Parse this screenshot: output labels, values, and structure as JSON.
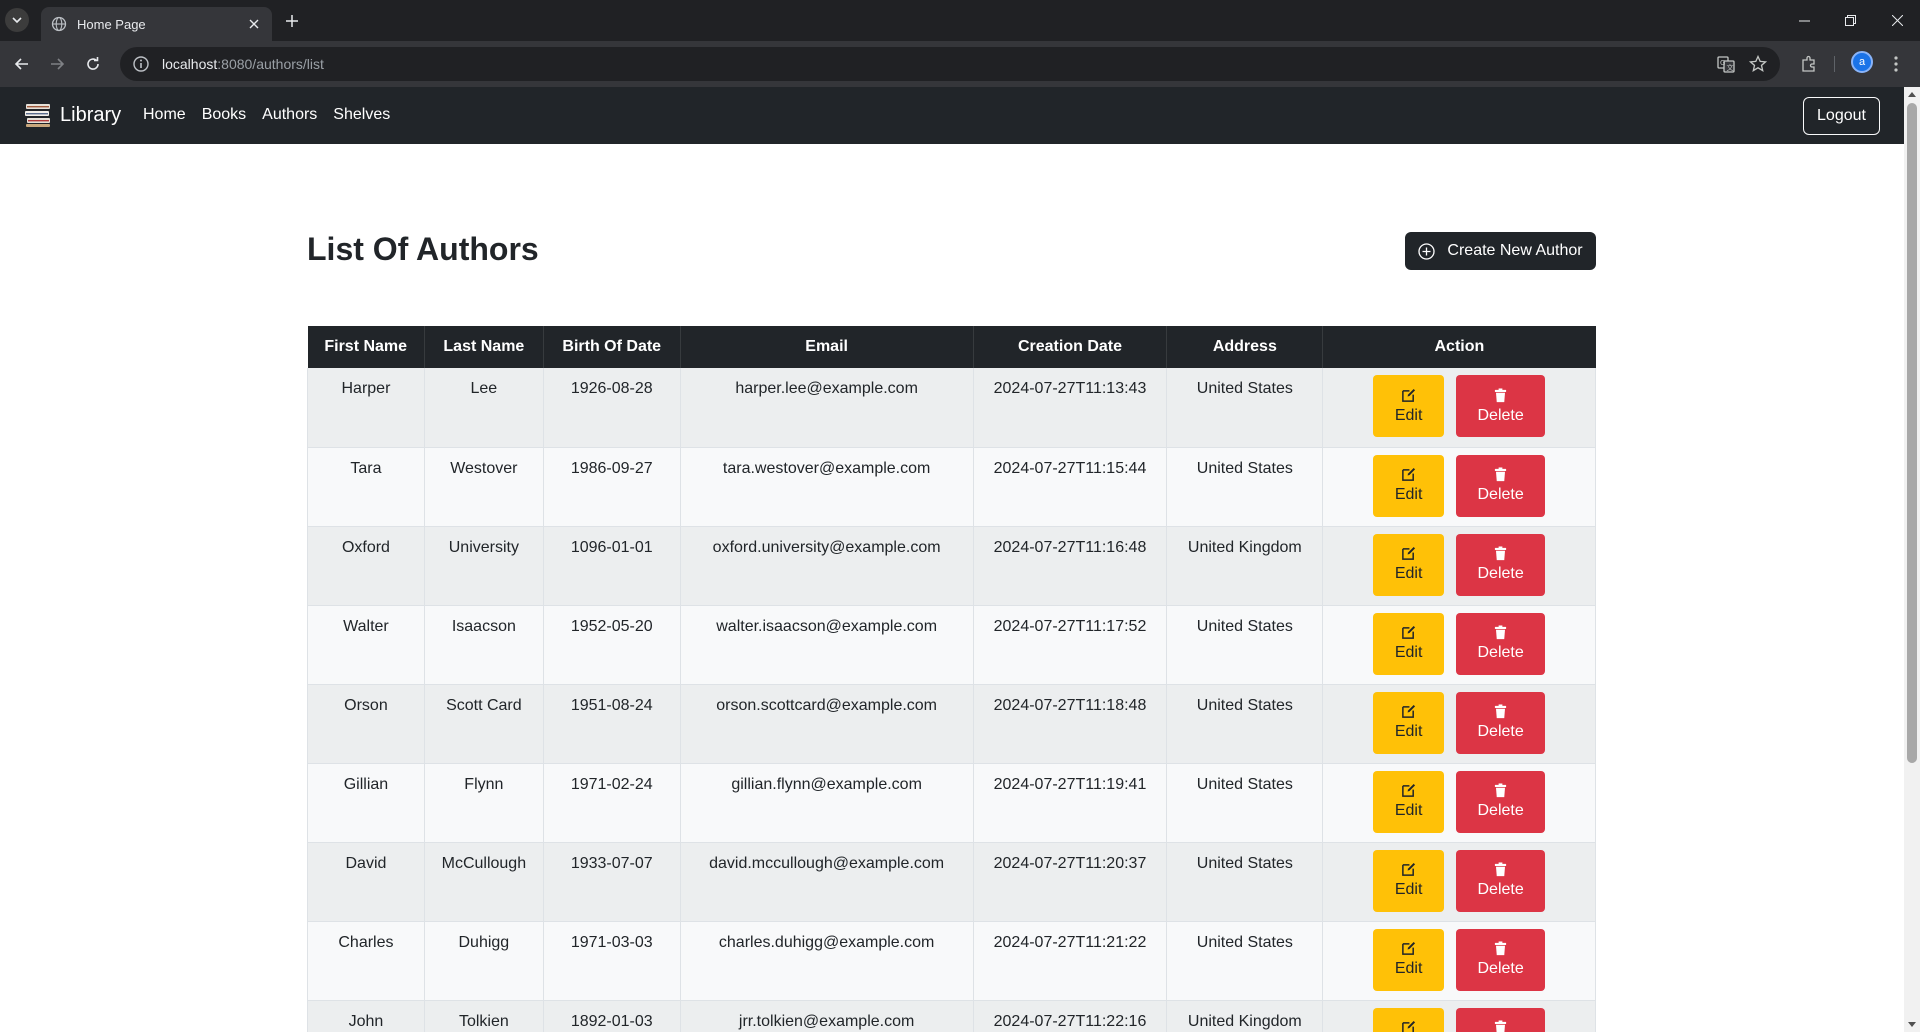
{
  "browser": {
    "tab_title": "Home Page",
    "url_host": "localhost",
    "url_path": ":8080/authors/list",
    "profile_initial": "a"
  },
  "navbar": {
    "brand": "Library",
    "links": [
      "Home",
      "Books",
      "Authors",
      "Shelves"
    ],
    "logout_label": "Logout"
  },
  "page": {
    "title": "List Of Authors",
    "create_label": "Create New Author"
  },
  "table": {
    "headers": [
      "First Name",
      "Last Name",
      "Birth Of Date",
      "Email",
      "Creation Date",
      "Address",
      "Action"
    ],
    "edit_label": "Edit",
    "delete_label": "Delete",
    "rows": [
      [
        "Harper",
        "Lee",
        "1926-08-28",
        "harper.lee@example.com",
        "2024-07-27T11:13:43",
        "United States"
      ],
      [
        "Tara",
        "Westover",
        "1986-09-27",
        "tara.westover@example.com",
        "2024-07-27T11:15:44",
        "United States"
      ],
      [
        "Oxford",
        "University",
        "1096-01-01",
        "oxford.university@example.com",
        "2024-07-27T11:16:48",
        "United Kingdom"
      ],
      [
        "Walter",
        "Isaacson",
        "1952-05-20",
        "walter.isaacson@example.com",
        "2024-07-27T11:17:52",
        "United States"
      ],
      [
        "Orson",
        "Scott Card",
        "1951-08-24",
        "orson.scottcard@example.com",
        "2024-07-27T11:18:48",
        "United States"
      ],
      [
        "Gillian",
        "Flynn",
        "1971-02-24",
        "gillian.flynn@example.com",
        "2024-07-27T11:19:41",
        "United States"
      ],
      [
        "David",
        "McCullough",
        "1933-07-07",
        "david.mccullough@example.com",
        "2024-07-27T11:20:37",
        "United States"
      ],
      [
        "Charles",
        "Duhigg",
        "1971-03-03",
        "charles.duhigg@example.com",
        "2024-07-27T11:21:22",
        "United States"
      ],
      [
        "John",
        "Tolkien",
        "1892-01-03",
        "jrr.tolkien@example.com",
        "2024-07-27T11:22:16",
        "United Kingdom"
      ]
    ]
  },
  "colors": {
    "navbar": "#212529",
    "edit": "#ffc107",
    "delete": "#dc3545"
  }
}
